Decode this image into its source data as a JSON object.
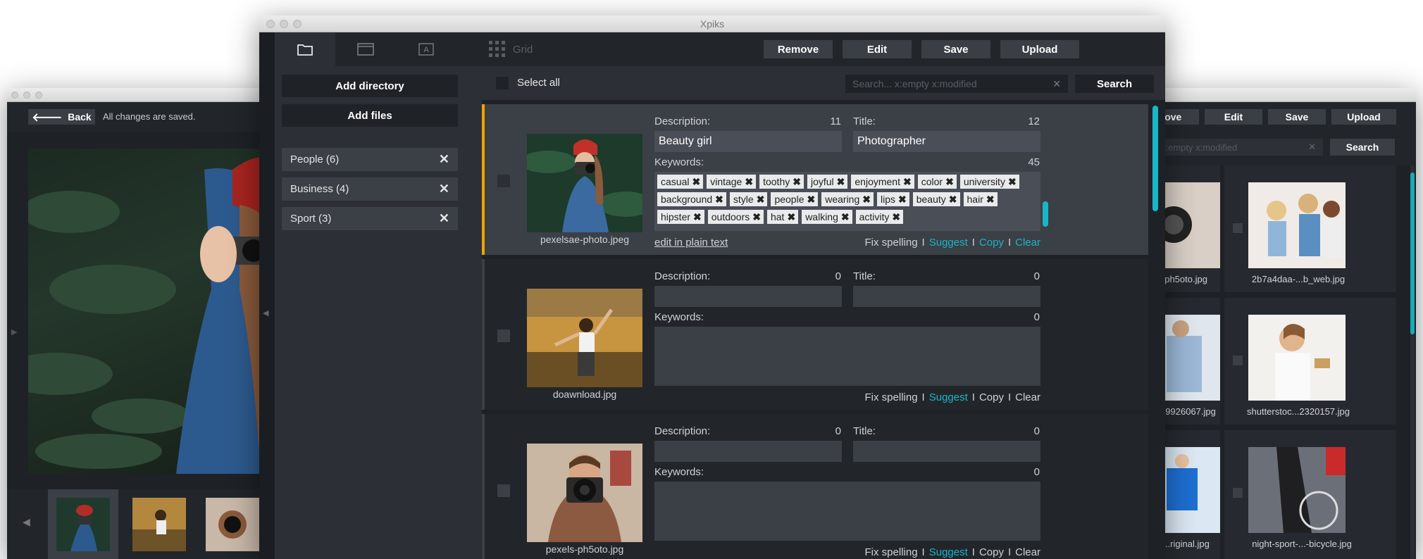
{
  "left_window": {
    "back_label": "Back",
    "status_text": "All changes are saved."
  },
  "right_window": {
    "buttons": [
      "nove",
      "Edit",
      "Save",
      "Upload"
    ],
    "search_placeholder": "x:empty  x:modified",
    "search_button": "Search",
    "thumbs": [
      {
        "caption": "...-ph5oto.jpg"
      },
      {
        "caption": "2b7a4daa-...b_web.jpg"
      },
      {
        "caption": "...c...9926067.jpg"
      },
      {
        "caption": "shutterstoc...2320157.jpg"
      },
      {
        "caption": "...-...riginal.jpg"
      },
      {
        "caption": "night-sport-...-bicycle.jpg"
      }
    ]
  },
  "main_window": {
    "title": "Xpiks",
    "toolbar": {
      "grid_label": "Grid",
      "remove": "Remove",
      "edit": "Edit",
      "save": "Save",
      "upload": "Upload"
    },
    "sidebar": {
      "add_directory": "Add directory",
      "add_files": "Add files",
      "directories": [
        {
          "label": "People (6)"
        },
        {
          "label": "Business (4)"
        },
        {
          "label": "Sport (3)"
        }
      ]
    },
    "select_all": "Select all",
    "search": {
      "placeholder": "Search...   x:empty  x:modified",
      "button": "Search"
    },
    "labels": {
      "description": "Description:",
      "title": "Title:",
      "keywords": "Keywords:",
      "edit_plain": "edit in plain text",
      "fix_spelling": "Fix spelling",
      "suggest": "Suggest",
      "copy": "Copy",
      "clear": "Clear",
      "sep": "I"
    },
    "items": [
      {
        "filename": "pexelsae-photo.jpeg",
        "description": "Beauty girl",
        "description_count": "11",
        "title": "Photographer",
        "title_count": "12",
        "keywords_count": "45",
        "keywords": [
          "casual",
          "vintage",
          "toothy",
          "joyful",
          "enjoyment",
          "color",
          "university",
          "background",
          "style",
          "people",
          "wearing",
          "lips",
          "beauty",
          "hair",
          "hipster",
          "outdoors",
          "hat",
          "walking",
          "activity"
        ]
      },
      {
        "filename": "doawnload.jpg",
        "description": "",
        "description_count": "0",
        "title": "",
        "title_count": "0",
        "keywords_count": "0",
        "keywords": []
      },
      {
        "filename": "pexels-ph5oto.jpg",
        "description": "",
        "description_count": "0",
        "title": "",
        "title_count": "0",
        "keywords_count": "0",
        "keywords": []
      }
    ]
  }
}
